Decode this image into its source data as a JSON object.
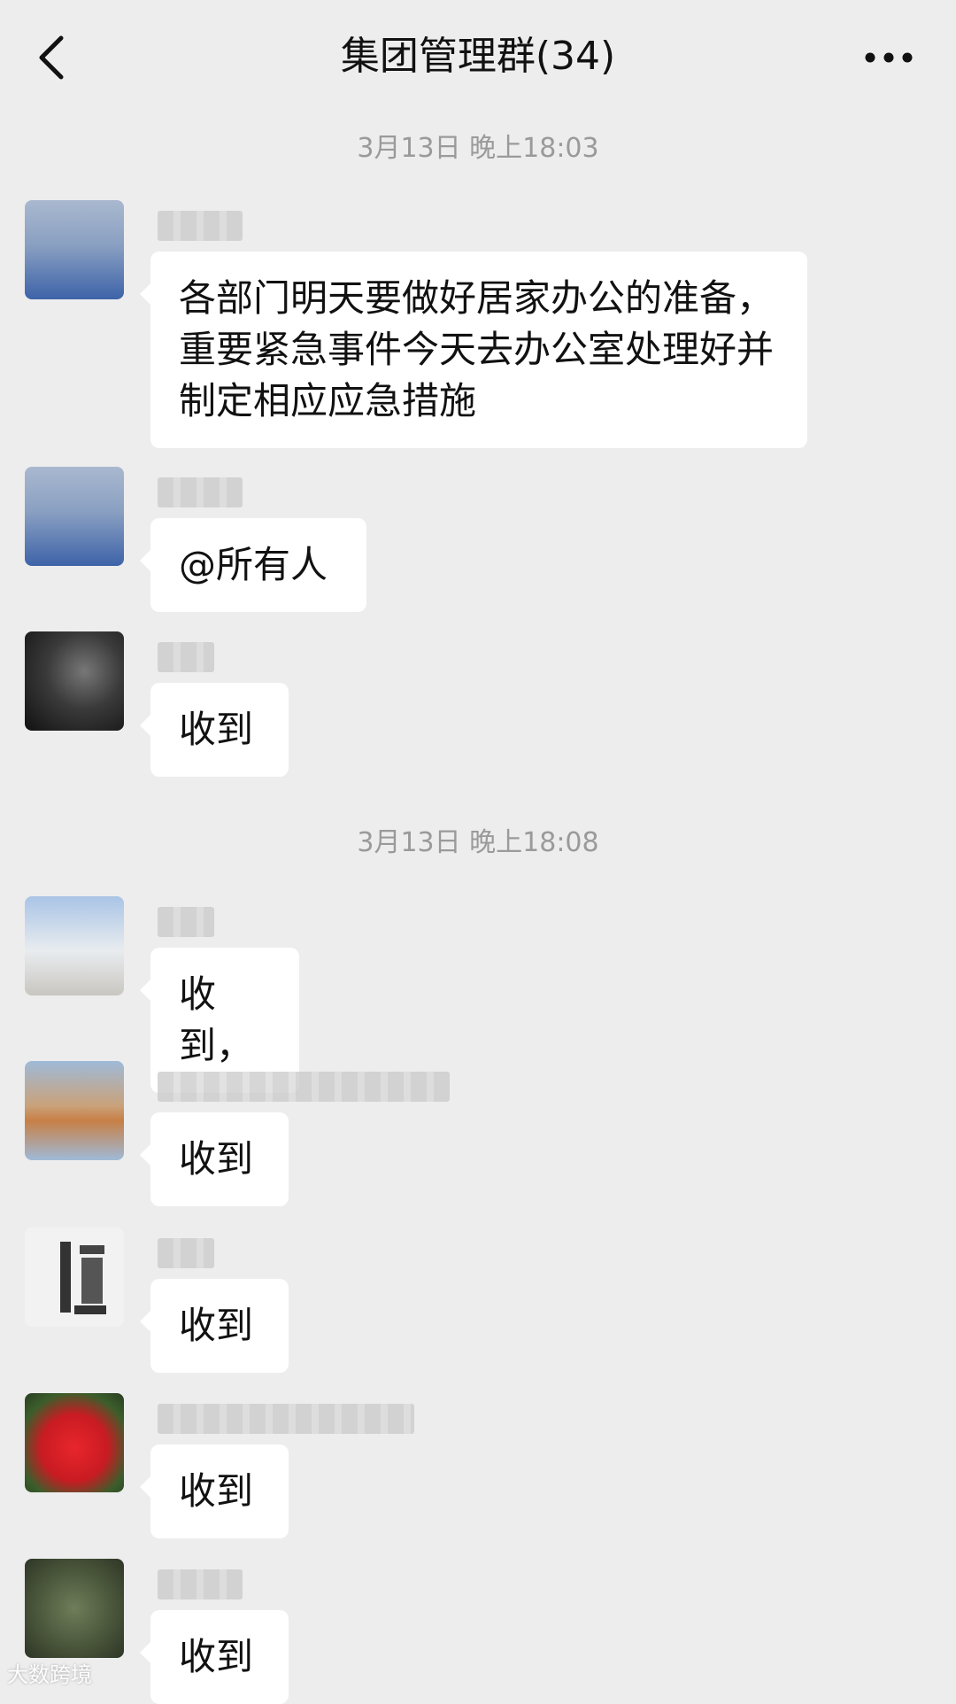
{
  "header": {
    "title": "集团管理群(34)"
  },
  "timestamps": [
    "3月13日 晚上18:03",
    "3月13日 晚上18:08"
  ],
  "messages": [
    {
      "text": "各部门明天要做好居家办公的准备，重要紧急事件今天去办公室处理好并制定相应应急措施"
    },
    {
      "text": "@所有人"
    },
    {
      "text": "收到"
    },
    {
      "text": "收到，"
    },
    {
      "text": "收到"
    },
    {
      "text": "收到"
    },
    {
      "text": "收到"
    },
    {
      "text": "收到"
    }
  ],
  "watermark": "大数跨境",
  "colors": {
    "background": "#ededed",
    "bubble": "#ffffff",
    "timestamp": "#9a9a9a"
  }
}
